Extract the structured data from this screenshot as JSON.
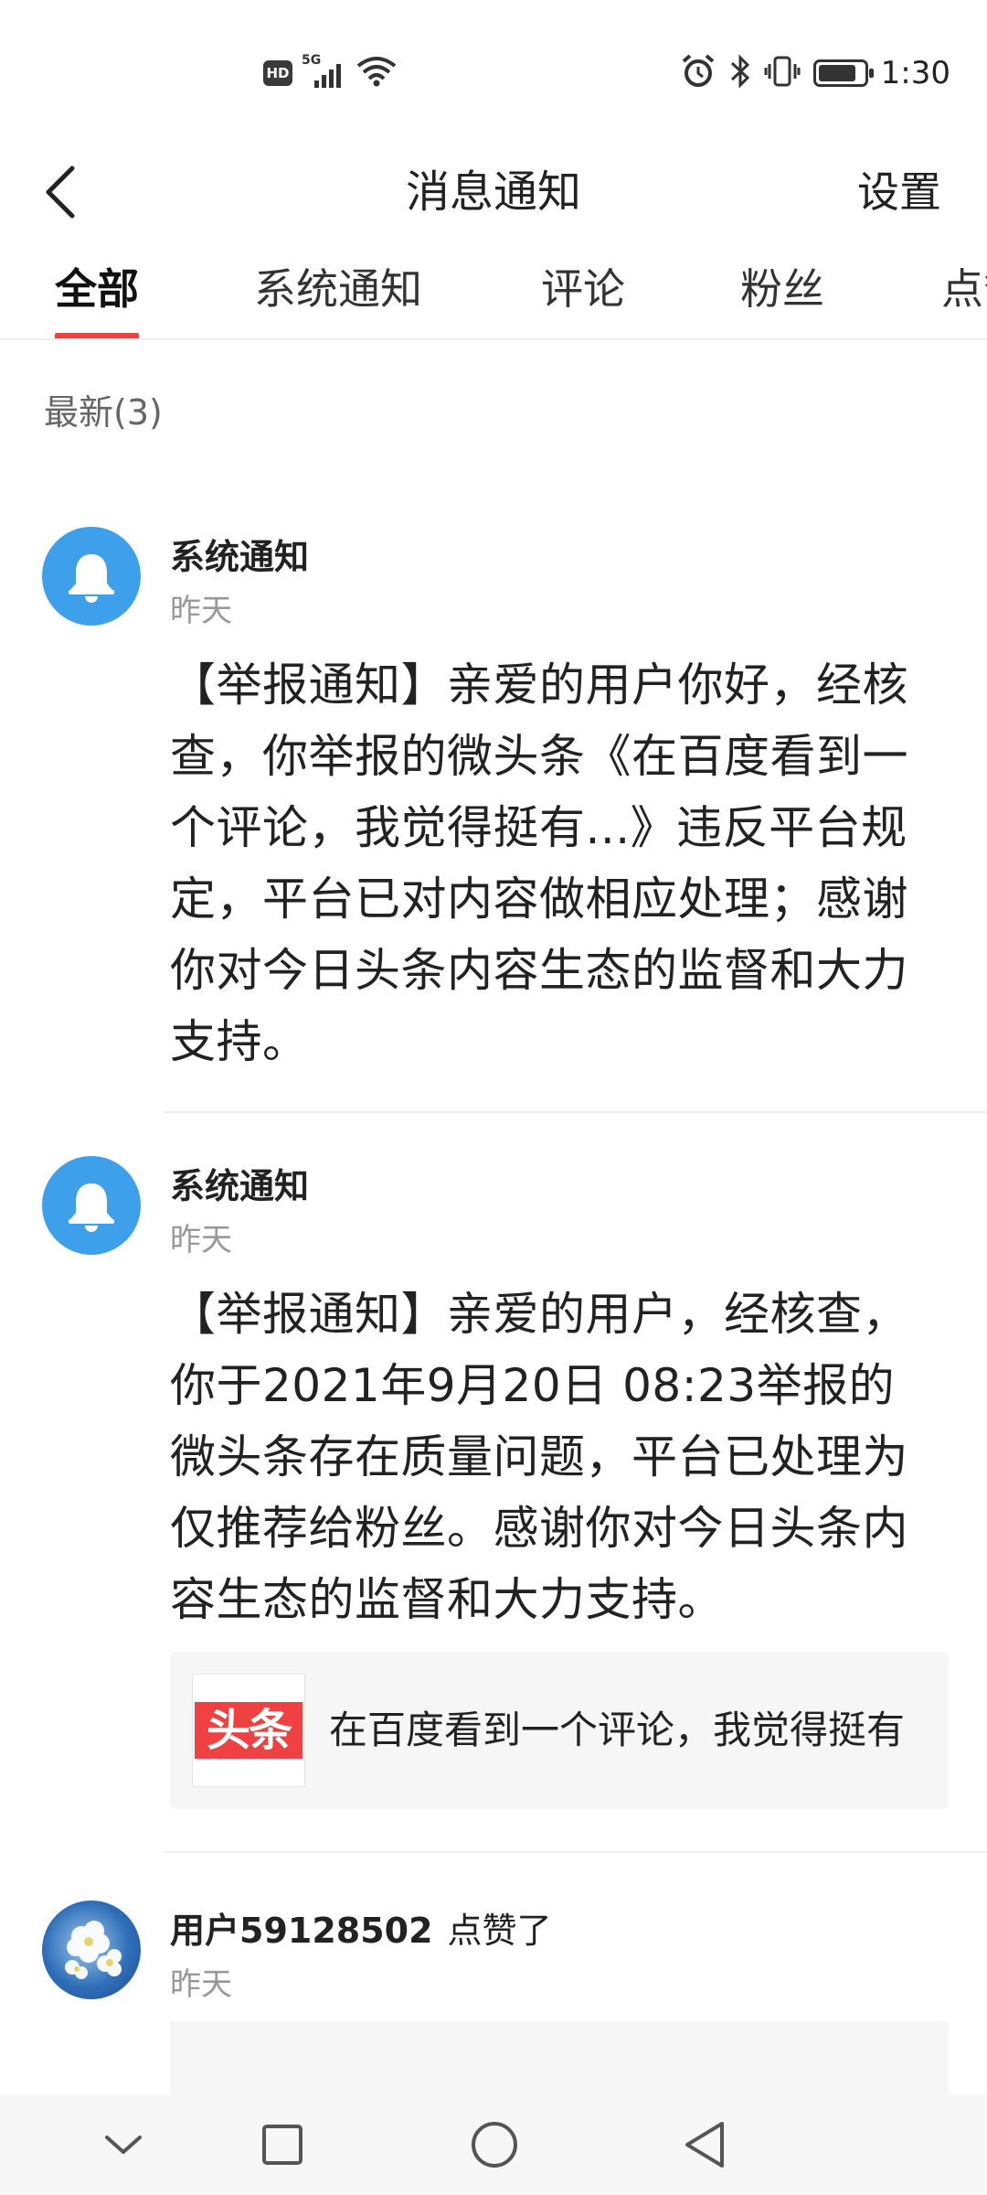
{
  "status_bar": {
    "hd": "HD",
    "network": "5G",
    "time": "1:30",
    "battery_level_percent": 85,
    "icons": [
      "hd-icon",
      "signal-icon",
      "wifi-icon",
      "alarm-icon",
      "bluetooth-icon",
      "vibrate-icon",
      "battery-icon"
    ]
  },
  "nav": {
    "title": "消息通知",
    "settings_label": "设置",
    "back_icon": "chevron-left-icon"
  },
  "tabs": [
    {
      "label": "全部",
      "active": true
    },
    {
      "label": "系统通知",
      "active": false
    },
    {
      "label": "评论",
      "active": false
    },
    {
      "label": "粉丝",
      "active": false
    },
    {
      "label": "点赞",
      "active": false
    }
  ],
  "accent_color": "#f04142",
  "avatar_color": "#3ea0ea",
  "section_label": "最新(3)",
  "messages": [
    {
      "name": "系统通知",
      "time": "昨天",
      "body": "【举报通知】亲爱的用户你好，经核查，你举报的微头条《在百度看到一个评论，我觉得挺有...》违反平台规定，平台已对内容做相应处理；感谢你对今日头条内容生态的监督和大力支持。",
      "avatar_icon": "bell-icon"
    },
    {
      "name": "系统通知",
      "time": "昨天",
      "body": "【举报通知】亲爱的用户，经核查，你于2021年9月20日 08:23举报的微头条存在质量问题，平台已处理为仅推荐给粉丝。感谢你对今日头条内容生态的监督和大力支持。",
      "avatar_icon": "bell-icon",
      "ref": {
        "logo_text": "头条",
        "text": "在百度看到一个评论，我觉得挺有"
      }
    },
    {
      "name": "用户59128502",
      "action": "点赞了",
      "time": "昨天",
      "avatar_icon": "flower-avatar-icon"
    }
  ],
  "system_nav": [
    "collapse-icon",
    "recents-icon",
    "home-icon",
    "back-icon"
  ]
}
